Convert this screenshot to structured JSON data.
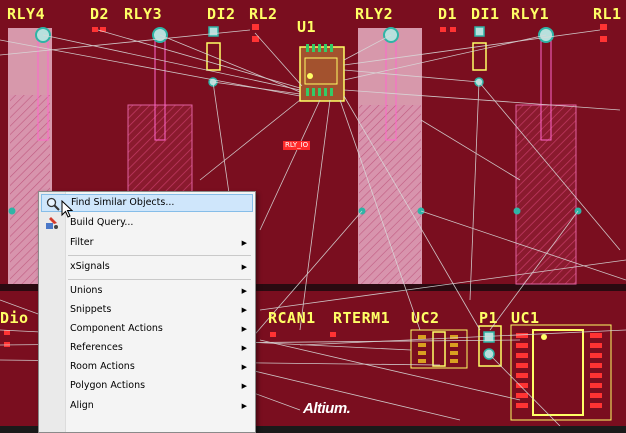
{
  "components": {
    "top": [
      "RLY4",
      "D2",
      "RLY3",
      "DI2",
      "RL2",
      "U1",
      "RLY2",
      "D1",
      "DI1",
      "RLY1",
      "RL1"
    ],
    "bottom": [
      "Dio",
      "RCAN1",
      "RTERM1",
      "UC2",
      "P1",
      "UC1"
    ]
  },
  "net_label": "RLY_IO",
  "brand": "Altium.",
  "menu": {
    "items": [
      {
        "label": "Find Similar Objects...",
        "has_submenu": false,
        "highlighted": true,
        "icon": "search-icon"
      },
      {
        "label": "Build Query...",
        "has_submenu": false,
        "highlighted": false,
        "icon": "query-icon"
      },
      {
        "label": "Filter",
        "has_submenu": true,
        "highlighted": false
      },
      {
        "label": "xSignals",
        "has_submenu": true,
        "highlighted": false
      },
      {
        "label": "Unions",
        "has_submenu": true,
        "highlighted": false
      },
      {
        "label": "Snippets",
        "has_submenu": true,
        "highlighted": false
      },
      {
        "label": "Component Actions",
        "has_submenu": true,
        "highlighted": false
      },
      {
        "label": "References",
        "has_submenu": true,
        "highlighted": false
      },
      {
        "label": "Room Actions",
        "has_submenu": true,
        "highlighted": false
      },
      {
        "label": "Polygon Actions",
        "has_submenu": true,
        "highlighted": false
      },
      {
        "label": "Align",
        "has_submenu": true,
        "highlighted": false
      }
    ],
    "submenu_arrow": "▶"
  },
  "colors": {
    "board": "#7a0e1f",
    "silkscreen": "#ffff66",
    "courtyard": "#e8b0c4",
    "ratsnest": "#d9d9d9",
    "pad": "#2fb4a6",
    "net_label_bg": "#ff2a2a",
    "menu_highlight": "#cfe6fb"
  }
}
